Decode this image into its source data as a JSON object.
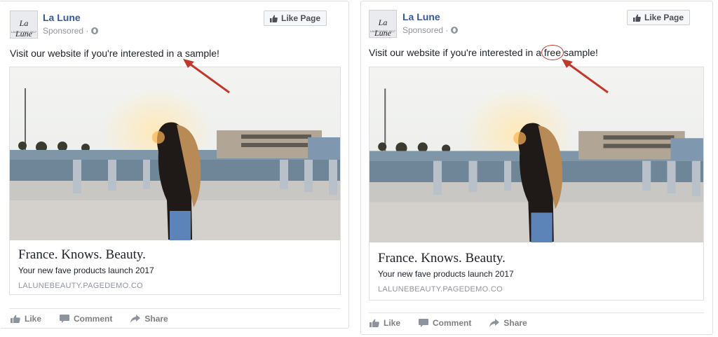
{
  "posts": [
    {
      "page_name": "La Lune",
      "logo_mark": "La Lune",
      "logo_small": "LAUNCHING 2017",
      "sponsored": "Sponsored ·",
      "like_page_label": "Like Page",
      "caption_before": "Visit our website if you're interested in a sample!",
      "headline": "France. Knows. Beauty.",
      "subline": "Your new fave products launch 2017",
      "domain": "LALUNEBEAUTY.PAGEDEMO.CO",
      "actions": [
        "Like",
        "Comment",
        "Share"
      ]
    },
    {
      "page_name": "La Lune",
      "logo_mark": "La Lune",
      "logo_small": "LAUNCHING 2017",
      "sponsored": "Sponsored ·",
      "like_page_label": "Like Page",
      "caption_before": "Visit our website if you're interested in a ",
      "caption_highlight": "free",
      "caption_after": " sample!",
      "headline": "France. Knows. Beauty.",
      "subline": "Your new fave products launch 2017",
      "domain": "LALUNEBEAUTY.PAGEDEMO.CO",
      "actions": [
        "Like",
        "Comment",
        "Share"
      ]
    }
  ],
  "colors": {
    "brand_link": "#365899",
    "annotation_red": "#c0392b",
    "muted": "#90949c"
  },
  "icons": {
    "like": "thumbs-up-icon",
    "comment": "comment-icon",
    "share": "share-arrow-icon",
    "privacy": "globe-icon"
  }
}
